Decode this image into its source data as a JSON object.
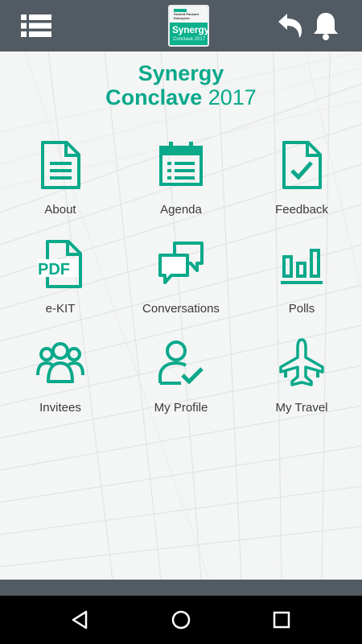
{
  "header": {
    "menu_icon": "hamburger-list-icon",
    "logo": {
      "brand_line1": "Hewlett Packard",
      "brand_line2": "Enterprise",
      "title": "Synergy",
      "subtitle": "Conclave 2017"
    },
    "back_icon": "undo-arrow-icon",
    "notification_icon": "bell-icon"
  },
  "main": {
    "title_line1": "Synergy",
    "title_line2_word": "Conclave",
    "title_line2_year": "2017",
    "tiles": [
      {
        "label": "About",
        "icon": "document-icon"
      },
      {
        "label": "Agenda",
        "icon": "calendar-list-icon"
      },
      {
        "label": "Feedback",
        "icon": "document-check-icon"
      },
      {
        "label": "e-KIT",
        "icon": "pdf-file-icon"
      },
      {
        "label": "Conversations",
        "icon": "chat-bubbles-icon"
      },
      {
        "label": "Polls",
        "icon": "bar-chart-icon"
      },
      {
        "label": "Invitees",
        "icon": "group-people-icon"
      },
      {
        "label": "My Profile",
        "icon": "user-check-icon"
      },
      {
        "label": "My Travel",
        "icon": "airplane-icon"
      }
    ]
  },
  "navigation_bar": {
    "back": "triangle-back-icon",
    "home": "circle-home-icon",
    "recents": "square-recents-icon"
  },
  "colors": {
    "accent": "#0aa98a",
    "topbar": "#525b63",
    "label_text": "#3a3a3a",
    "system_bar": "#000000"
  }
}
